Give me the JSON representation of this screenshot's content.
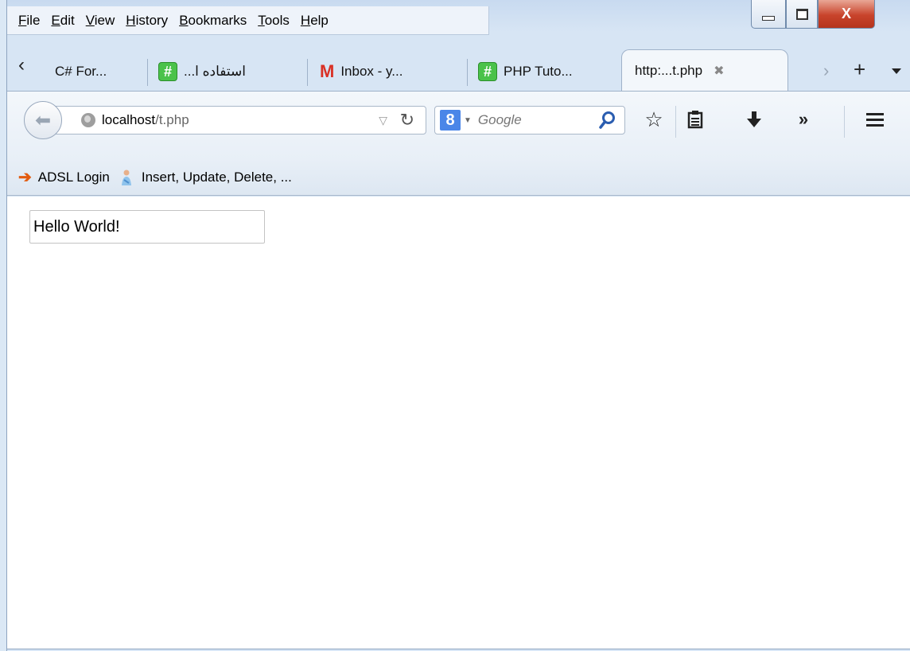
{
  "menu": [
    "File",
    "Edit",
    "View",
    "History",
    "Bookmarks",
    "Tools",
    "Help"
  ],
  "window_controls": {
    "close": "X"
  },
  "tabs": [
    {
      "label": "C# For...",
      "icon": "none"
    },
    {
      "label": "...استفاده ا",
      "icon": "hash-icon"
    },
    {
      "label": "Inbox - y...",
      "icon": "gmail-icon"
    },
    {
      "label": "PHP Tuto...",
      "icon": "hash-icon"
    },
    {
      "label": "http:...t.php",
      "icon": "none",
      "active": true
    }
  ],
  "navbar": {
    "url_host": "localhost",
    "url_path": "/t.php",
    "search_engine_letter": "8",
    "search_placeholder": "Google"
  },
  "bookmarks": [
    {
      "label": "ADSL Login",
      "icon": "arrow-icon"
    },
    {
      "label": "Insert, Update, Delete, ...",
      "icon": "person-icon"
    }
  ],
  "page": {
    "textbox_value": "Hello World!"
  },
  "colors": {
    "close_button": "#c8432b",
    "accent": "#4a86e8",
    "hash_favicon": "#4ac24a"
  }
}
